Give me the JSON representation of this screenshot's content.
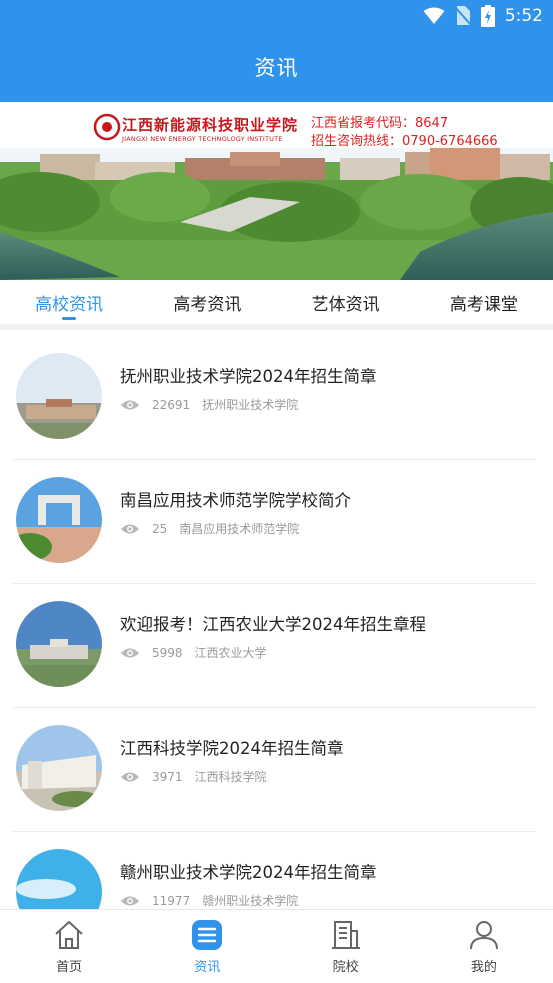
{
  "status_bar": {
    "time": "5:52"
  },
  "header": {
    "title": "资讯"
  },
  "banner": {
    "school_name": "江西新能源科技职业学院",
    "school_name_en": "JIANGXI NEW ENERGY TECHNOLOGY INSTITUTE",
    "exam_code_text": "江西省报考代码：8647",
    "hotline_text": "招生咨询热线：0790-6764666"
  },
  "tabs": [
    {
      "label": "高校资讯",
      "active": true
    },
    {
      "label": "高考资讯",
      "active": false
    },
    {
      "label": "艺体资讯",
      "active": false
    },
    {
      "label": "高考课堂",
      "active": false
    }
  ],
  "articles": [
    {
      "title": "抚州职业技术学院2024年招生简章",
      "views": "22691",
      "source": "抚州职业技术学院"
    },
    {
      "title": "南昌应用技术师范学院学校简介",
      "views": "25",
      "source": "南昌应用技术师范学院"
    },
    {
      "title": "欢迎报考！江西农业大学2024年招生章程",
      "views": "5998",
      "source": "江西农业大学"
    },
    {
      "title": "江西科技学院2024年招生简章",
      "views": "3971",
      "source": "江西科技学院"
    },
    {
      "title": "赣州职业技术学院2024年招生简章",
      "views": "11977",
      "source": "赣州职业技术学院"
    }
  ],
  "bottom_nav": [
    {
      "label": "首页",
      "icon": "home-icon",
      "active": false
    },
    {
      "label": "资讯",
      "icon": "news-icon",
      "active": true
    },
    {
      "label": "院校",
      "icon": "school-icon",
      "active": false
    },
    {
      "label": "我的",
      "icon": "user-icon",
      "active": false
    }
  ],
  "colors": {
    "primary": "#2f93eb",
    "text": "#222222",
    "muted": "#9a9a9a"
  }
}
